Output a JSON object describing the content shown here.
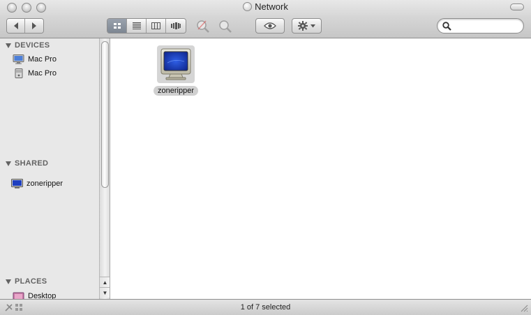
{
  "window": {
    "title": "Network"
  },
  "toolbar": {
    "back_icon": "chevron-left-icon",
    "forward_icon": "chevron-right-icon",
    "view_modes": [
      "icon-view",
      "list-view",
      "column-view",
      "cover-flow-view"
    ],
    "active_view": "icon-view",
    "quicklook_icon": "eye-icon",
    "action_icon": "gear-icon"
  },
  "search": {
    "value": "",
    "placeholder": ""
  },
  "sidebar": {
    "sections": [
      {
        "label": "DEVICES",
        "items": [
          {
            "label": "Mac Pro",
            "icon": "computer-icon"
          },
          {
            "label": "Mac Pro",
            "icon": "hard-drive-icon"
          }
        ]
      },
      {
        "label": "SHARED",
        "items": [
          {
            "label": "zoneripper",
            "icon": "monitor-icon"
          }
        ]
      },
      {
        "label": "PLACES",
        "items": [
          {
            "label": "Desktop",
            "icon": "desktop-folder-icon"
          }
        ]
      }
    ]
  },
  "content": {
    "items": [
      {
        "label": "zoneripper",
        "icon": "crt-monitor-icon",
        "selected": true
      }
    ]
  },
  "status": {
    "text": "1 of 7 selected"
  },
  "colors": {
    "selection": "#d0d0d0",
    "sidebar_bg": "#e8e8e8",
    "screen_blue": "#1e3fc0"
  }
}
